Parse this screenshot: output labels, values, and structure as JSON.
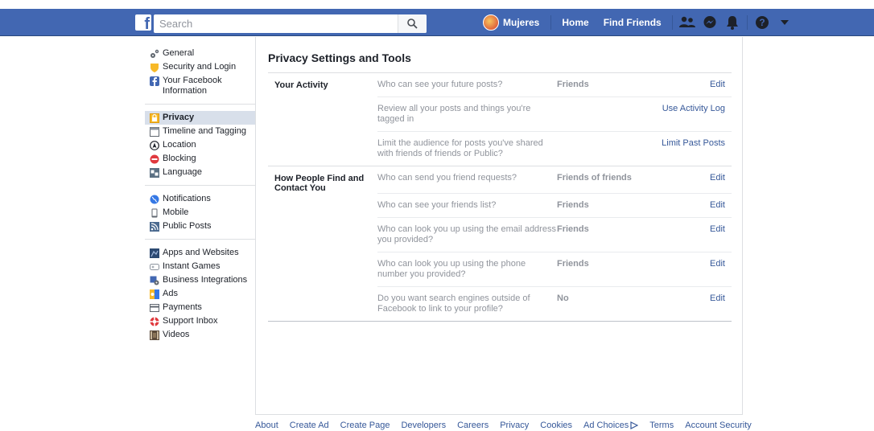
{
  "topbar": {
    "logo": "f",
    "search_placeholder": "Search",
    "user_name": "Mujeres",
    "links": [
      "Home",
      "Find Friends"
    ],
    "icons": [
      "friend-requests-icon",
      "messenger-icon",
      "notifications-icon",
      "help-icon",
      "account-menu-icon"
    ]
  },
  "sidebar": {
    "groups": [
      [
        {
          "label": "General",
          "icon": "gears-icon"
        },
        {
          "label": "Security and Login",
          "icon": "shield-icon"
        },
        {
          "label": "Your Facebook Information",
          "icon": "facebook-icon"
        }
      ],
      [
        {
          "label": "Privacy",
          "icon": "lock-icon",
          "active": true
        },
        {
          "label": "Timeline and Tagging",
          "icon": "timeline-icon"
        },
        {
          "label": "Location",
          "icon": "location-icon"
        },
        {
          "label": "Blocking",
          "icon": "blocking-icon"
        },
        {
          "label": "Language",
          "icon": "language-icon"
        }
      ],
      [
        {
          "label": "Notifications",
          "icon": "globe-icon"
        },
        {
          "label": "Mobile",
          "icon": "mobile-icon"
        },
        {
          "label": "Public Posts",
          "icon": "rss-icon"
        }
      ],
      [
        {
          "label": "Apps and Websites",
          "icon": "apps-icon"
        },
        {
          "label": "Instant Games",
          "icon": "games-icon"
        },
        {
          "label": "Business Integrations",
          "icon": "business-icon"
        },
        {
          "label": "Ads",
          "icon": "ads-icon"
        },
        {
          "label": "Payments",
          "icon": "payments-icon"
        },
        {
          "label": "Support Inbox",
          "icon": "support-icon"
        },
        {
          "label": "Videos",
          "icon": "videos-icon"
        }
      ]
    ]
  },
  "main": {
    "title": "Privacy Settings and Tools",
    "sections": [
      {
        "name": "Your Activity",
        "rows": [
          {
            "question": "Who can see your future posts?",
            "value": "Friends",
            "action": "Edit"
          },
          {
            "question": "Review all your posts and things you're tagged in",
            "value": "",
            "action": "Use Activity Log"
          },
          {
            "question": "Limit the audience for posts you've shared with friends of friends or Public?",
            "value": "",
            "action": "Limit Past Posts"
          }
        ]
      },
      {
        "name": "How People Find and Contact You",
        "rows": [
          {
            "question": "Who can send you friend requests?",
            "value": "Friends of friends",
            "action": "Edit"
          },
          {
            "question": "Who can see your friends list?",
            "value": "Friends",
            "action": "Edit"
          },
          {
            "question": "Who can look you up using the email address you provided?",
            "value": "Friends",
            "action": "Edit"
          },
          {
            "question": "Who can look you up using the phone number you provided?",
            "value": "Friends",
            "action": "Edit"
          },
          {
            "question": "Do you want search engines outside of Facebook to link to your profile?",
            "value": "No",
            "action": "Edit"
          }
        ]
      }
    ]
  },
  "footer": {
    "links": [
      "About",
      "Create Ad",
      "Create Page",
      "Developers",
      "Careers",
      "Privacy",
      "Cookies",
      "Ad Choices",
      "Terms",
      "Account Security"
    ]
  },
  "colors": {
    "brand": "#4267b2",
    "link": "#365899",
    "active_bg": "#d8dfea"
  }
}
